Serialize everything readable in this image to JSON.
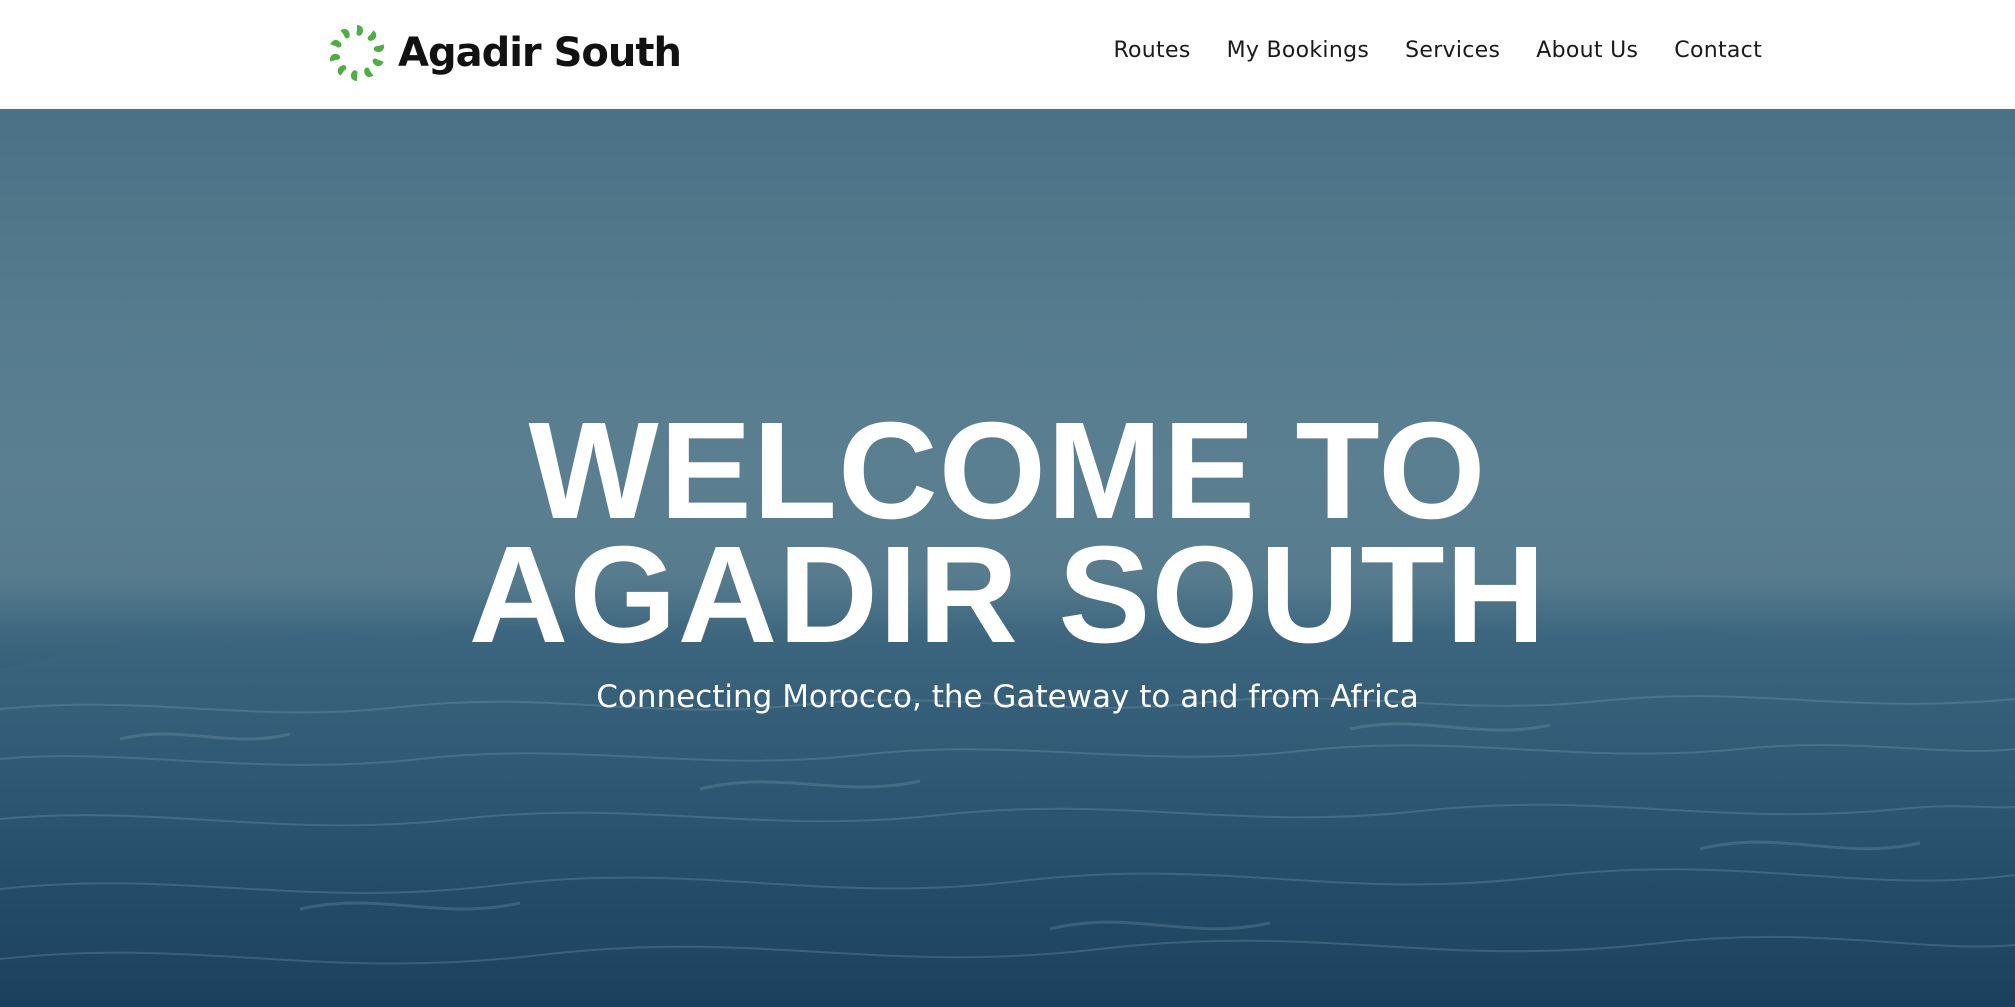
{
  "brand": {
    "name": "Agadir South",
    "logo_color": "#4caf3f"
  },
  "nav": {
    "items": [
      {
        "label": "Routes"
      },
      {
        "label": "My Bookings"
      },
      {
        "label": "Services"
      },
      {
        "label": "About Us"
      },
      {
        "label": "Contact"
      }
    ]
  },
  "hero": {
    "title_line1": "WELCOME TO",
    "title_line2": "AGADIR SOUTH",
    "subtitle": "Connecting Morocco, the Gateway to and from Africa",
    "background": "ocean-waves-image"
  },
  "colors": {
    "header_bg": "#ffffff",
    "hero_sky": "#557b8e",
    "hero_sea": "#27506c",
    "text_on_hero": "#ffffff"
  }
}
